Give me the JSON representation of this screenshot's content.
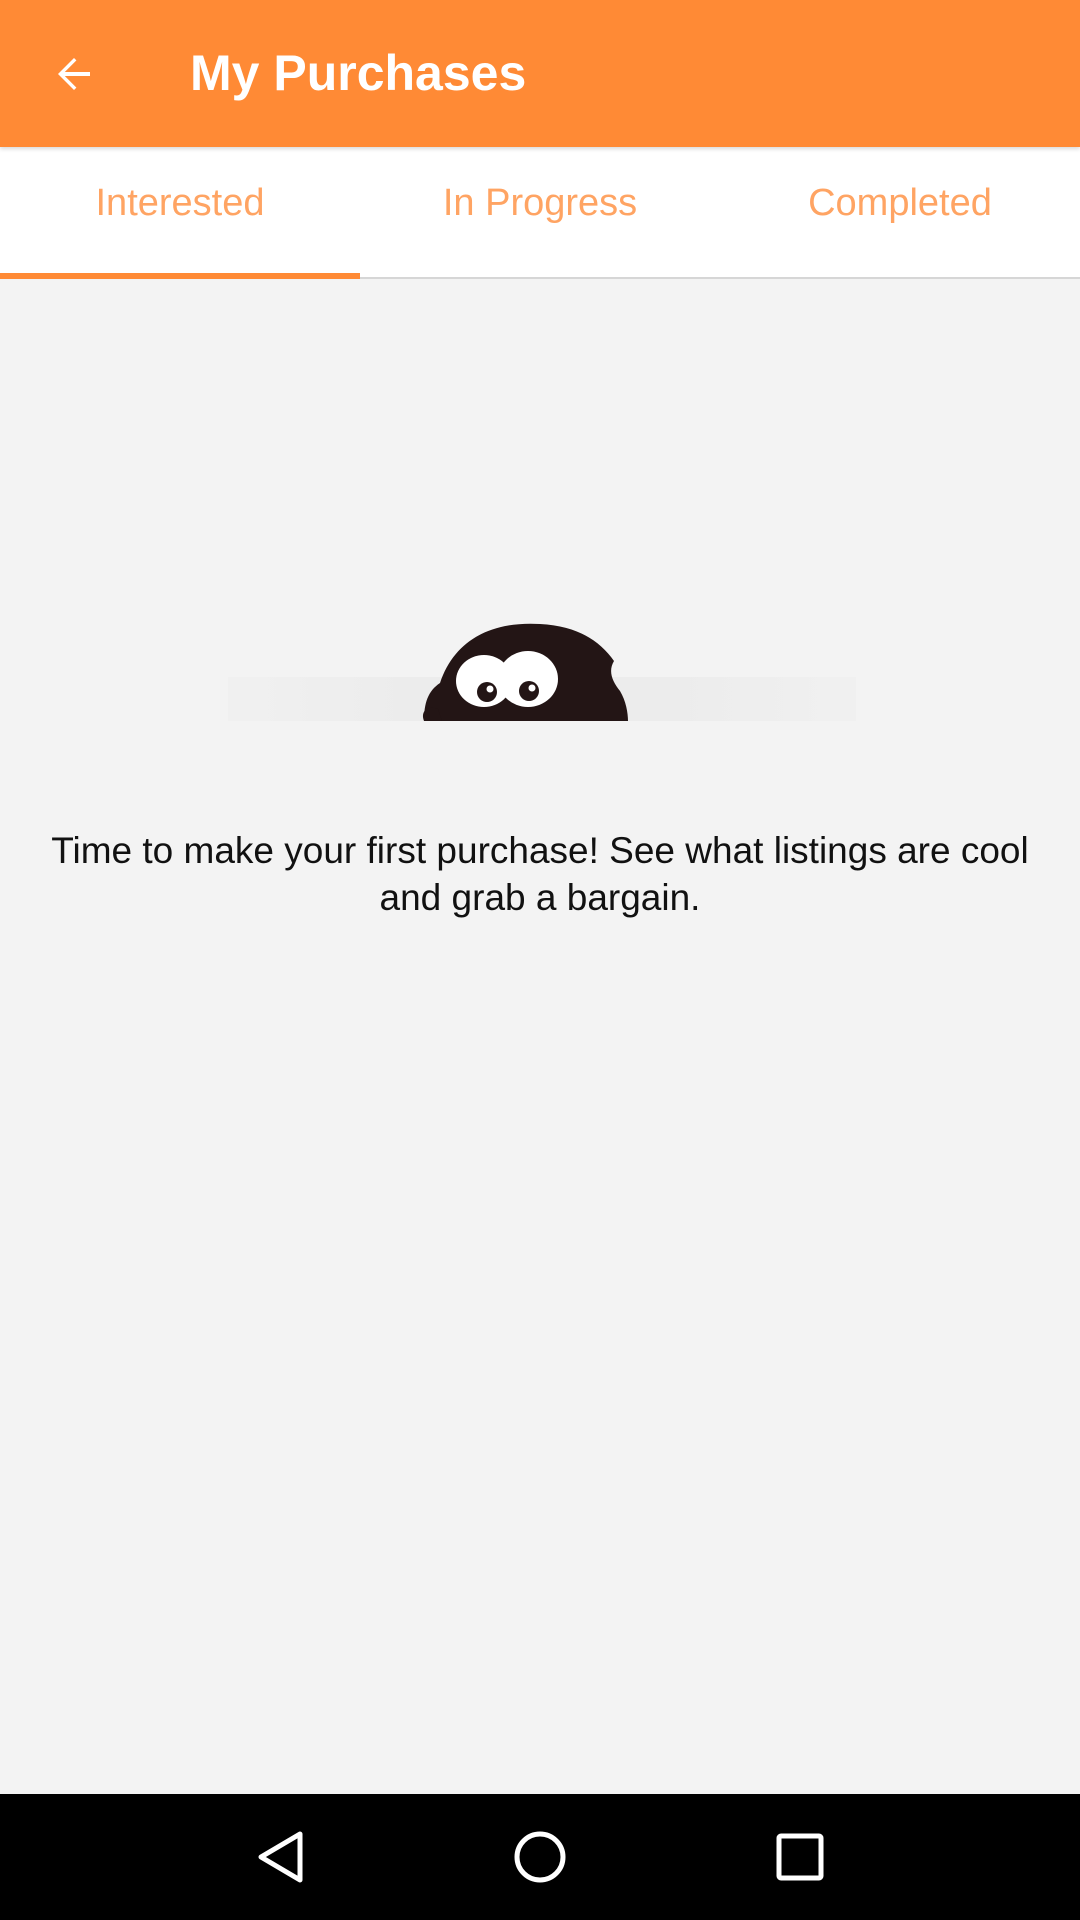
{
  "app_bar": {
    "title": "My Purchases",
    "back_icon": "arrow-left-icon",
    "background_color": "#ff8a35"
  },
  "tabs": [
    {
      "label": "Interested",
      "selected": true
    },
    {
      "label": "In Progress",
      "selected": false
    },
    {
      "label": "Completed",
      "selected": false
    }
  ],
  "empty_state": {
    "illustration": "peeking-mascot-icon",
    "message": "Time to make your first purchase! See what listings are cool and grab a bargain."
  },
  "nav_bar": {
    "back_icon": "nav-back-triangle-icon",
    "home_icon": "nav-home-circle-icon",
    "recents_icon": "nav-recents-square-icon"
  },
  "colors": {
    "accent": "#ff8a35",
    "tab_text": "#ffa463",
    "content_bg": "#f3f3f3"
  }
}
